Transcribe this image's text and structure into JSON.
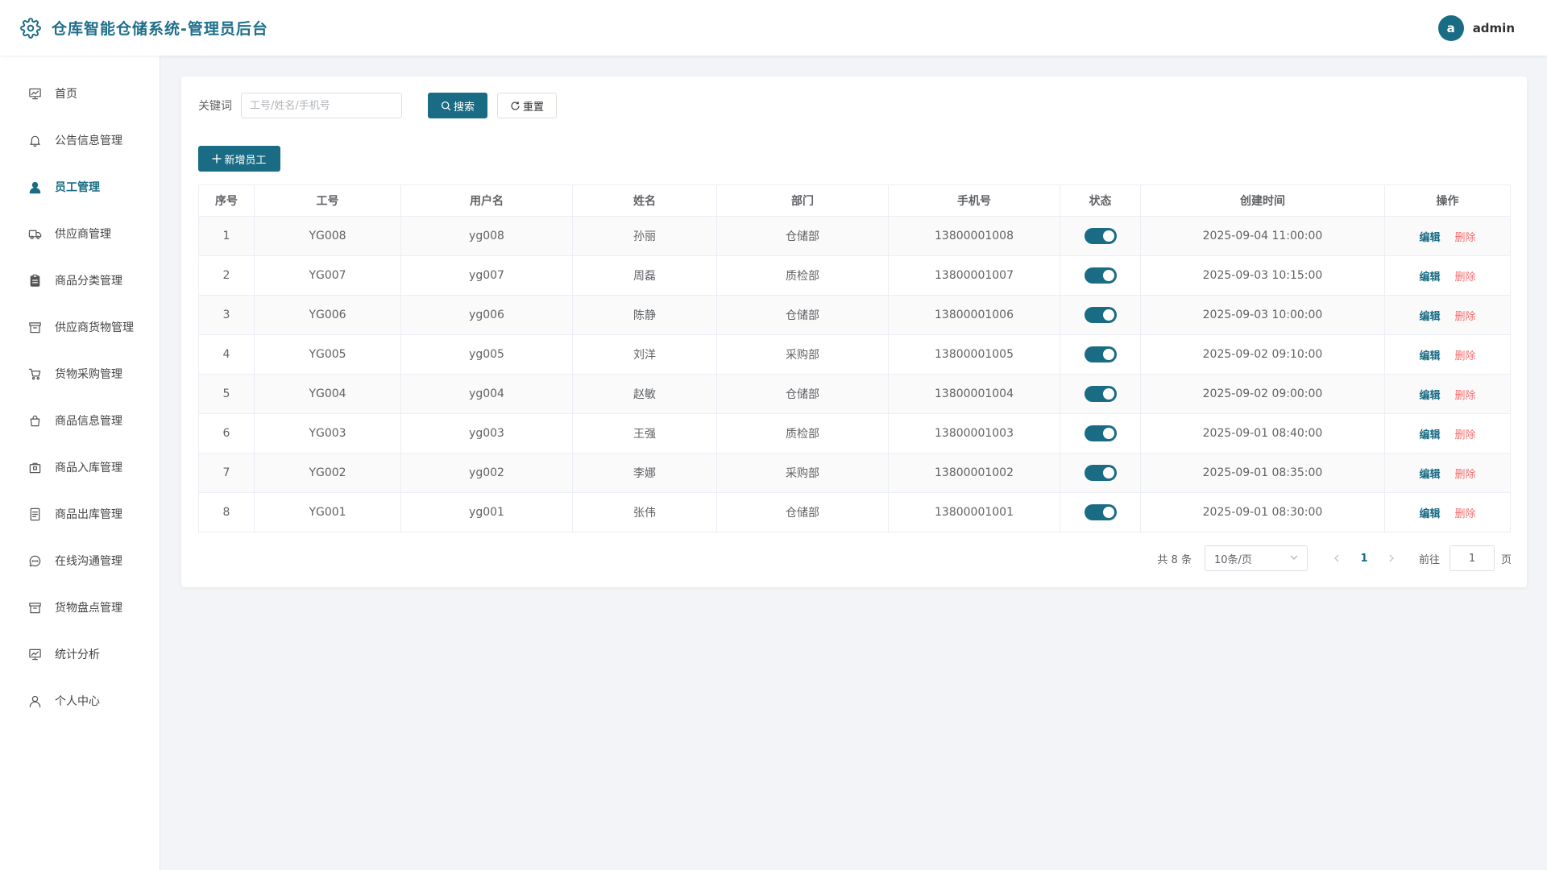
{
  "header": {
    "title": "仓库智能仓储系统-管理员后台",
    "avatar_letter": "a",
    "username": "admin"
  },
  "sidebar": {
    "items": [
      {
        "label": "首页",
        "icon": "chart-board-icon"
      },
      {
        "label": "公告信息管理",
        "icon": "bell-icon"
      },
      {
        "label": "员工管理",
        "icon": "user-filled-icon",
        "active": true
      },
      {
        "label": "供应商管理",
        "icon": "truck-icon"
      },
      {
        "label": "商品分类管理",
        "icon": "clipboard-icon"
      },
      {
        "label": "供应商货物管理",
        "icon": "box-icon"
      },
      {
        "label": "货物采购管理",
        "icon": "cart-icon"
      },
      {
        "label": "商品信息管理",
        "icon": "bag-icon"
      },
      {
        "label": "商品入库管理",
        "icon": "package-icon"
      },
      {
        "label": "商品出库管理",
        "icon": "document-icon"
      },
      {
        "label": "在线沟通管理",
        "icon": "chat-icon"
      },
      {
        "label": "货物盘点管理",
        "icon": "box-icon"
      },
      {
        "label": "统计分析",
        "icon": "chart-board-icon"
      },
      {
        "label": "个人中心",
        "icon": "user-icon"
      }
    ]
  },
  "search": {
    "label": "关键词",
    "placeholder": "工号/姓名/手机号",
    "value": "",
    "search_label": "搜索",
    "reset_label": "重置"
  },
  "toolbar": {
    "add_label": "新增员工"
  },
  "table": {
    "columns": [
      "序号",
      "工号",
      "用户名",
      "姓名",
      "部门",
      "手机号",
      "状态",
      "创建时间",
      "操作"
    ],
    "edit_label": "编辑",
    "delete_label": "删除",
    "rows": [
      {
        "index": "1",
        "emp_no": "YG008",
        "username": "yg008",
        "name": "孙丽",
        "dept": "仓储部",
        "phone": "13800001008",
        "status_on": true,
        "created": "2025-09-04 11:00:00"
      },
      {
        "index": "2",
        "emp_no": "YG007",
        "username": "yg007",
        "name": "周磊",
        "dept": "质检部",
        "phone": "13800001007",
        "status_on": true,
        "created": "2025-09-03 10:15:00"
      },
      {
        "index": "3",
        "emp_no": "YG006",
        "username": "yg006",
        "name": "陈静",
        "dept": "仓储部",
        "phone": "13800001006",
        "status_on": true,
        "created": "2025-09-03 10:00:00"
      },
      {
        "index": "4",
        "emp_no": "YG005",
        "username": "yg005",
        "name": "刘洋",
        "dept": "采购部",
        "phone": "13800001005",
        "status_on": true,
        "created": "2025-09-02 09:10:00"
      },
      {
        "index": "5",
        "emp_no": "YG004",
        "username": "yg004",
        "name": "赵敏",
        "dept": "仓储部",
        "phone": "13800001004",
        "status_on": true,
        "created": "2025-09-02 09:00:00"
      },
      {
        "index": "6",
        "emp_no": "YG003",
        "username": "yg003",
        "name": "王强",
        "dept": "质检部",
        "phone": "13800001003",
        "status_on": true,
        "created": "2025-09-01 08:40:00"
      },
      {
        "index": "7",
        "emp_no": "YG002",
        "username": "yg002",
        "name": "李娜",
        "dept": "采购部",
        "phone": "13800001002",
        "status_on": true,
        "created": "2025-09-01 08:35:00"
      },
      {
        "index": "8",
        "emp_no": "YG001",
        "username": "yg001",
        "name": "张伟",
        "dept": "仓储部",
        "phone": "13800001001",
        "status_on": true,
        "created": "2025-09-01 08:30:00"
      }
    ]
  },
  "pagination": {
    "total_text": "共 8 条",
    "page_size": "10条/页",
    "current_page": "1",
    "goto_label": "前往",
    "goto_value": "1",
    "goto_suffix": "页"
  },
  "colors": {
    "primary": "#1a6c85",
    "danger": "#f56c6c",
    "background": "#f2f4f7"
  }
}
